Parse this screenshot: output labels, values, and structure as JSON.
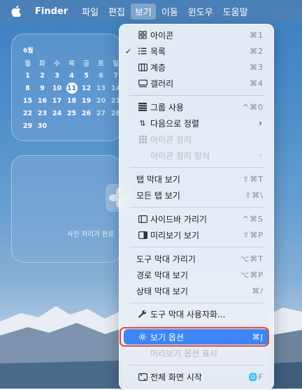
{
  "menubar": {
    "app_name": "Finder",
    "items": [
      "파일",
      "편집",
      "보기",
      "이동",
      "윈도우",
      "도움말"
    ]
  },
  "calendar": {
    "month": "6월",
    "weekdays": [
      "월",
      "화",
      "수",
      "목",
      "금",
      "토",
      "일"
    ],
    "weeks": [
      [
        "1",
        "2",
        "3",
        "4",
        "5",
        "6",
        "7"
      ],
      [
        "8",
        "9",
        "10",
        "11",
        "12",
        "13",
        "14"
      ],
      [
        "15",
        "16",
        "17",
        "18",
        "19",
        "20",
        "21"
      ],
      [
        "22",
        "23",
        "24",
        "25",
        "26",
        "27",
        "28"
      ],
      [
        "29",
        "30",
        "",
        "",
        "",
        "",
        ""
      ]
    ],
    "today": "11"
  },
  "photo_widget": {
    "text": "사진 처리가 완료"
  },
  "view_menu": {
    "items": {
      "as_icons": {
        "label": "아이콘",
        "shortcut": "⌘1"
      },
      "as_list": {
        "label": "목록",
        "shortcut": "⌘2",
        "checked": "✓"
      },
      "as_columns": {
        "label": "계층",
        "shortcut": "⌘3"
      },
      "as_gallery": {
        "label": "갤러리",
        "shortcut": "⌘4"
      },
      "use_groups": {
        "label": "그룹 사용",
        "shortcut": "^⌘0"
      },
      "sort_by": {
        "label": "다음으로 정렬"
      },
      "clean_up": {
        "label": "아이콘 정리"
      },
      "clean_up_by": {
        "label": "아이콘 정리 방식"
      },
      "show_tab_bar": {
        "label": "탭 막대 보기",
        "shortcut": "⇧⌘T"
      },
      "show_all_tabs": {
        "label": "모든 탭 보기",
        "shortcut": "⇧⌘\\"
      },
      "hide_sidebar": {
        "label": "사이드바 가리기",
        "shortcut": "^⌘S"
      },
      "show_preview": {
        "label": "미리보기 보기",
        "shortcut": "⇧⌘P"
      },
      "hide_toolbar": {
        "label": "도구 막대 가리기",
        "shortcut": "⌥⌘T"
      },
      "show_path_bar": {
        "label": "경로 막대 보기",
        "shortcut": "⌥⌘P"
      },
      "show_status_bar": {
        "label": "상태 막대 보기",
        "shortcut": "⌘/"
      },
      "customize_toolbar": {
        "label": "도구 막대 사용자화..."
      },
      "view_options": {
        "label": "보기 옵션",
        "shortcut": "⌘J"
      },
      "preview_options": {
        "label": "미리보기 옵션 표시"
      },
      "enter_full_screen": {
        "label": "전체 화면 시작",
        "shortcut": "🌐F"
      }
    }
  },
  "colors": {
    "highlight": "#3d86f5",
    "annotation_box": "#e5473f"
  }
}
